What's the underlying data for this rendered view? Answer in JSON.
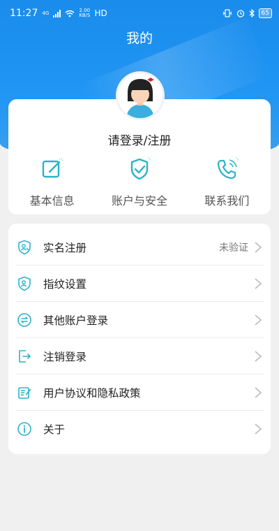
{
  "status_bar": {
    "time": "11:27",
    "network": "4G",
    "speed_value": "2.00",
    "speed_unit": "KB/S",
    "hd": "HD",
    "battery": "65"
  },
  "page": {
    "title": "我的"
  },
  "profile": {
    "login_label": "请登录/注册",
    "quick_actions": [
      {
        "label": "基本信息",
        "icon": "edit-icon"
      },
      {
        "label": "账户与安全",
        "icon": "shield-check-icon"
      },
      {
        "label": "联系我们",
        "icon": "phone-icon"
      }
    ]
  },
  "menu": {
    "items": [
      {
        "label": "实名注册",
        "value": "未验证",
        "icon": "id-shield-icon"
      },
      {
        "label": "指纹设置",
        "value": "",
        "icon": "fingerprint-shield-icon"
      },
      {
        "label": "其他账户登录",
        "value": "",
        "icon": "switch-account-icon"
      },
      {
        "label": "注销登录",
        "value": "",
        "icon": "logout-icon"
      },
      {
        "label": "用户协议和隐私政策",
        "value": "",
        "icon": "agreement-icon"
      },
      {
        "label": "关于",
        "value": "",
        "icon": "info-icon"
      }
    ]
  },
  "colors": {
    "brand_blue": "#2196f3",
    "icon_cyan": "#2bb3c8",
    "background": "#f0f0f0"
  }
}
